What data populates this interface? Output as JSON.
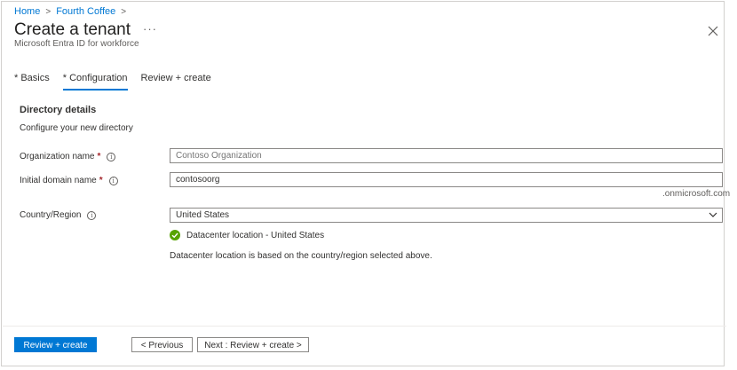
{
  "breadcrumb": {
    "items": [
      "Home",
      "Fourth Coffee"
    ],
    "separator": ">"
  },
  "header": {
    "title": "Create a tenant",
    "more": "···",
    "subtitle": "Microsoft Entra ID for workforce"
  },
  "tabs": [
    {
      "label": "Basics",
      "required": true,
      "active": false
    },
    {
      "label": "Configuration",
      "required": true,
      "active": true
    },
    {
      "label": "Review + create",
      "required": false,
      "active": false
    }
  ],
  "section": {
    "title": "Directory details",
    "description": "Configure your new directory"
  },
  "form": {
    "org_name": {
      "label": "Organization name",
      "required_mark": "*",
      "placeholder": "Contoso Organization",
      "value": ""
    },
    "domain_name": {
      "label": "Initial domain name",
      "required_mark": "*",
      "value": "contosoorg",
      "suffix": ".onmicrosoft.com"
    },
    "country": {
      "label": "Country/Region",
      "selected": "United States"
    },
    "datacenter_status": "Datacenter location - United States",
    "datacenter_note": "Datacenter location is based on the country/region selected above."
  },
  "footer": {
    "review_create": "Review + create",
    "previous": "< Previous",
    "next": "Next : Review + create >"
  },
  "colors": {
    "accent": "#0078d4",
    "required": "#a4262c",
    "success": "#57a300"
  },
  "icons": {
    "close": "close-icon",
    "info": "info-icon",
    "chevron": "chevron-down-icon",
    "check": "checkmark-circle-icon"
  }
}
